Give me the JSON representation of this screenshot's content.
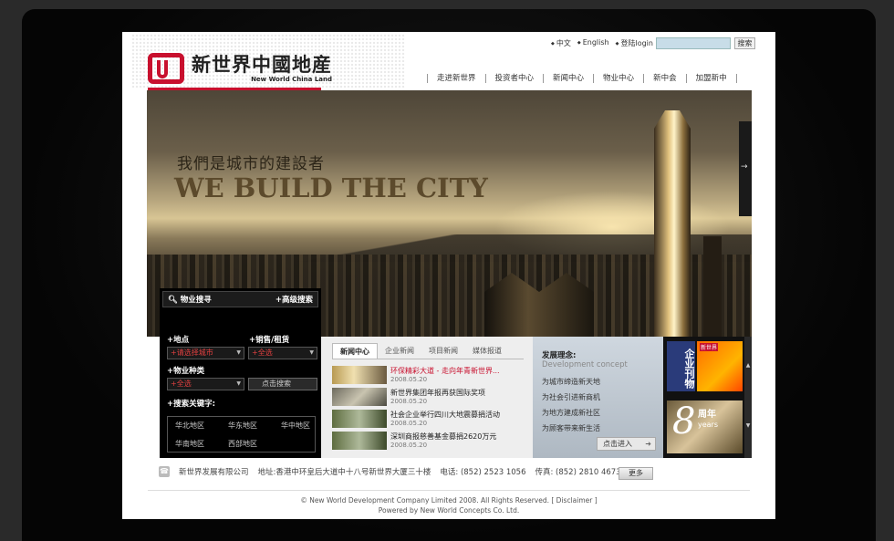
{
  "header": {
    "logo_cn": "新世界中國地産",
    "logo_en": "New World China Land",
    "top_links": [
      "中文",
      "English",
      "登陆login"
    ],
    "search_placeholder": "",
    "search_button": "搜索",
    "nav": [
      "走进新世界",
      "投资者中心",
      "新闻中心",
      "物业中心",
      "新中会",
      "加盟新中"
    ]
  },
  "hero": {
    "tagline": "我們是城市的建設者",
    "title": "WE BUILD THE CITY",
    "side_arrow": "→"
  },
  "property_search": {
    "title": "物业搜寻",
    "advanced": "+高级搜索",
    "location_label": "+地点",
    "location_value": "+请选择城市",
    "sale_label": "+销售/租赁",
    "sale_value": "+全选",
    "type_label": "+物业种类",
    "type_value": "+全选",
    "search_button": "点击搜索",
    "keyword_label": "+搜索关键字:",
    "regions": [
      "华北地区",
      "华东地区",
      "华中地区",
      "华南地区",
      "西部地区"
    ]
  },
  "news": {
    "tabs": [
      "新闻中心",
      "企业新闻",
      "项目新闻",
      "媒体报道"
    ],
    "items": [
      {
        "title": "环保精彩大道 - 走向年青新世界...",
        "date": "2008.05.20"
      },
      {
        "title": "新世界集团年报再获国际奖项",
        "date": "2008.05.20"
      },
      {
        "title": "社会企业举行四川大地震募捐活动",
        "date": "2008.05.20"
      },
      {
        "title": "深圳商报慈善基金募捐2620万元",
        "date": "2008.05.20"
      }
    ]
  },
  "concept": {
    "title": "发展理念:",
    "subtitle": "Development concept",
    "lines": [
      "为城市缔造新天地",
      "为社会引进新商机",
      "为地方建成新社区",
      "为顾客带来新生活"
    ],
    "enter": "点击进入"
  },
  "promo": {
    "banner1": "企业刊物",
    "banner2_tag": "新世界",
    "anniversary_number": "8",
    "anniversary_text": "周年",
    "anniversary_en": "years"
  },
  "footer": {
    "company": "新世界发展有限公司",
    "address": "地址:香港中环皇后大道中十八号新世界大厦三十楼",
    "phone": "电话: (852) 2523 1056",
    "fax": "传真: (852) 2810 4673",
    "more": "更多",
    "copyright": "© New World Development Company Limited 2008. All Rights Reserved. [ Disclaimer ]",
    "powered": "Powered by New World Concepts Co. Ltd."
  },
  "colors": {
    "brand_red": "#c8102e",
    "frame_dark": "#050505"
  }
}
